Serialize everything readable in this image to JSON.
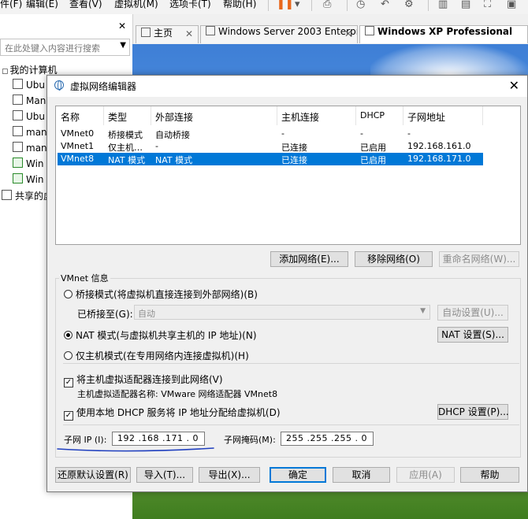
{
  "menubar": {
    "items": [
      "件(F)",
      "编辑(E)",
      "查看(V)",
      "虚拟机(M)",
      "选项卡(T)",
      "帮助(H)"
    ]
  },
  "library": {
    "search_placeholder": "在此处键入内容进行搜索",
    "my_computer": "我的计算机",
    "items": [
      "Ubu",
      "Man",
      "Ubu",
      "man",
      "man",
      "Win",
      "Win"
    ],
    "shared": "共享的虚"
  },
  "tabs": [
    {
      "label": "主页",
      "active": false
    },
    {
      "label": "Windows Server 2003 Enterpr…",
      "active": false
    },
    {
      "label": "Windows XP Professional",
      "active": true
    }
  ],
  "dialog": {
    "title": "虚拟网络编辑器",
    "columns": [
      "名称",
      "类型",
      "外部连接",
      "主机连接",
      "DHCP",
      "子网地址"
    ],
    "rows": [
      {
        "name": "VMnet0",
        "type": "桥接模式",
        "external": "自动桥接",
        "host": "-",
        "dhcp": "-",
        "subnet": "-",
        "selected": false
      },
      {
        "name": "VMnet1",
        "type": "仅主机…",
        "external": "-",
        "host": "已连接",
        "dhcp": "已启用",
        "subnet": "192.168.161.0",
        "selected": false
      },
      {
        "name": "VMnet8",
        "type": "NAT 模式",
        "external": "NAT 模式",
        "host": "已连接",
        "dhcp": "已启用",
        "subnet": "192.168.171.0",
        "selected": true
      }
    ],
    "add_network": "添加网络(E)...",
    "remove_network": "移除网络(O)",
    "rename_network": "重命名网络(W)...",
    "group_label": "VMnet 信息",
    "bridge_mode": "桥接模式(将虚拟机直接连接到外部网络)(B)",
    "bridged_to_label": "已桥接至(G):",
    "bridged_to_value": "自动",
    "auto_settings": "自动设置(U)...",
    "nat_mode": "NAT 模式(与虚拟机共享主机的 IP 地址)(N)",
    "nat_settings": "NAT 设置(S)...",
    "host_only": "仅主机模式(在专用网络内连接虚拟机)(H)",
    "connect_adapter": "将主机虚拟适配器连接到此网络(V)",
    "adapter_name": "主机虚拟适配器名称: VMware 网络适配器 VMnet8",
    "use_dhcp": "使用本地 DHCP 服务将 IP 地址分配给虚拟机(D)",
    "dhcp_settings": "DHCP 设置(P)...",
    "subnet_ip_label": "子网 IP (I):",
    "subnet_ip_value": "192 .168 .171 . 0",
    "subnet_mask_label": "子网掩码(M):",
    "subnet_mask_value": "255 .255 .255 . 0",
    "restore_defaults": "还原默认设置(R)",
    "import": "导入(T)...",
    "export": "导出(X)...",
    "ok": "确定",
    "cancel": "取消",
    "apply": "应用(A)",
    "help": "帮助"
  },
  "colors": {
    "selection": "#0078d7",
    "annotation_underline": "#1f3fbf"
  }
}
